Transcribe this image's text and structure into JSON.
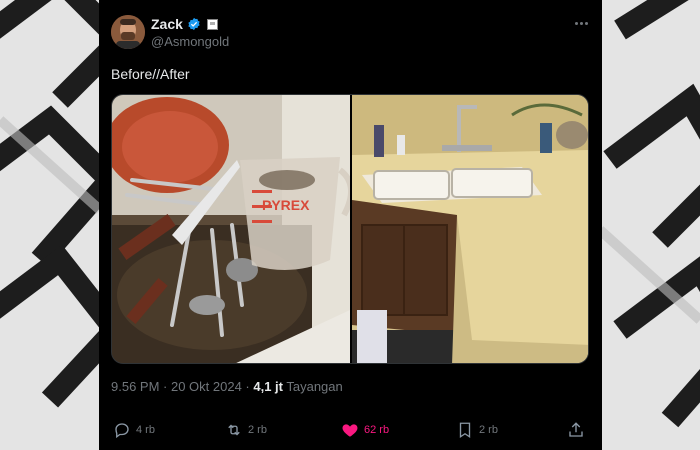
{
  "post": {
    "author_name": "Zack",
    "author_handle": "@Asmongold",
    "text": "Before//After",
    "timestamp": "9.56 PM · 20 Okt 2024 · ",
    "views_count": "4,1 jt",
    "views_label": " Tayangan",
    "media_alt": [
      "before-dirty-sink-with-dishes",
      "after-clean-sink-counter"
    ]
  },
  "actions": {
    "reply_count": "4 rb",
    "repost_count": "2 rb",
    "like_count": "62 rb",
    "bookmark_count": "2 rb"
  },
  "photo_text": {
    "pyrex": "PYREX"
  },
  "colors": {
    "card_bg": "#000000",
    "text_primary": "#e7e9ea",
    "text_secondary": "#71767b",
    "verified_blue": "#1d9bf0",
    "like_pink": "#f91880"
  },
  "icons": [
    "verified-badge-icon",
    "more-options-icon",
    "reply-icon",
    "repost-icon",
    "like-heart-icon",
    "bookmark-icon",
    "share-icon"
  ]
}
